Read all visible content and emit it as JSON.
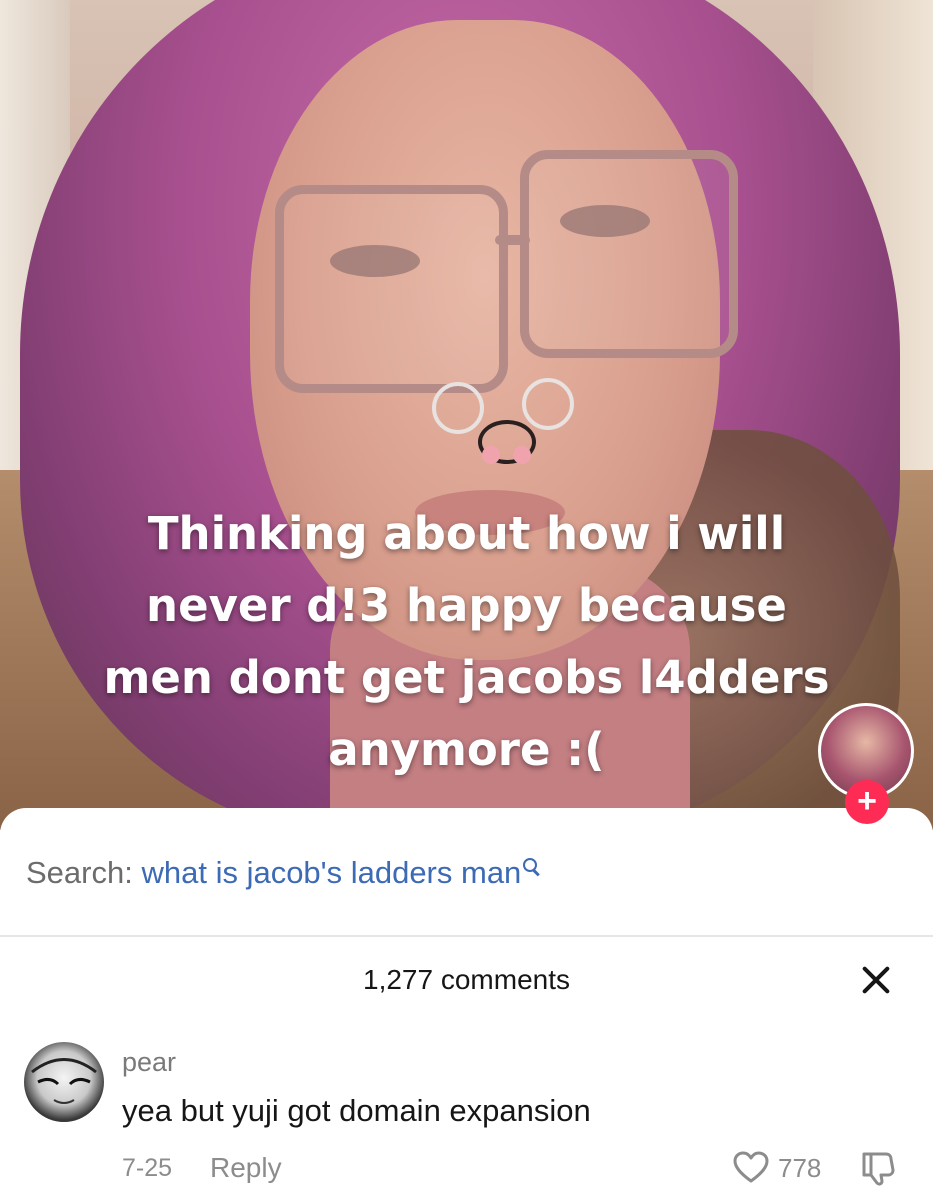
{
  "video": {
    "caption_lines": [
      "Thinking about how i will",
      "never d!3 happy because",
      "men dont get jacobs l4dders",
      "anymore :("
    ],
    "follow_symbol": "+"
  },
  "search": {
    "label": "Search:",
    "query": "what is jacob's ladders man",
    "icon": "search-icon"
  },
  "comments": {
    "count_label": "1,277 comments",
    "close_icon": "close-icon",
    "items": [
      {
        "username": "pear",
        "text": "yea but yuji got domain expansion",
        "date": "7-25",
        "reply_label": "Reply",
        "likes": "778",
        "like_icon": "heart-icon",
        "dislike_icon": "dislike-icon"
      }
    ]
  },
  "colors": {
    "search_query": "#3d6ab5",
    "follow_button": "#fe2c55",
    "muted_text": "#8c8c8c"
  }
}
